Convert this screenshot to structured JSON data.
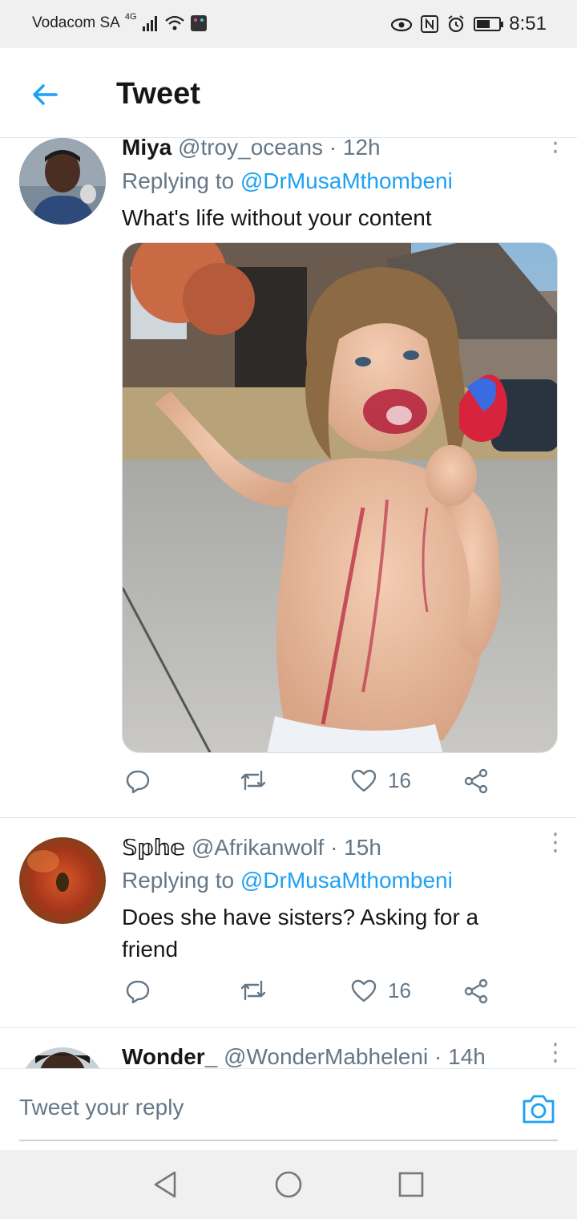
{
  "status_bar": {
    "carrier": "Vodacom SA",
    "network": "4G",
    "time": "8:51"
  },
  "header": {
    "title": "Tweet",
    "back_icon": "arrow-left-icon"
  },
  "colors": {
    "accent": "#1da1f2",
    "secondary_text": "#657786",
    "primary_text": "#14171a",
    "divider": "#e1e8ed"
  },
  "tweets": [
    {
      "name": "Miya",
      "handle": "@troy_oceans",
      "time": "· 12h",
      "replying_prefix": "Replying to",
      "replying_handle": "@DrMusaMthombeni",
      "text": "What's life without your content",
      "likes": "16"
    },
    {
      "name": "𝕊𝕡𝕙𝕖",
      "handle": "@Afrikanwolf",
      "time": "· 15h",
      "replying_prefix": "Replying to",
      "replying_handle": "@DrMusaMthombeni",
      "text": "Does she have sisters? Asking for a friend",
      "likes": "16"
    },
    {
      "name": "Wonder_",
      "handle": "@WonderMabheleni",
      "time": "· 14h"
    }
  ],
  "composer": {
    "placeholder": "Tweet your reply"
  },
  "nav_bar": {
    "icons": [
      "back-triangle-icon",
      "home-circle-icon",
      "recents-square-icon"
    ]
  }
}
